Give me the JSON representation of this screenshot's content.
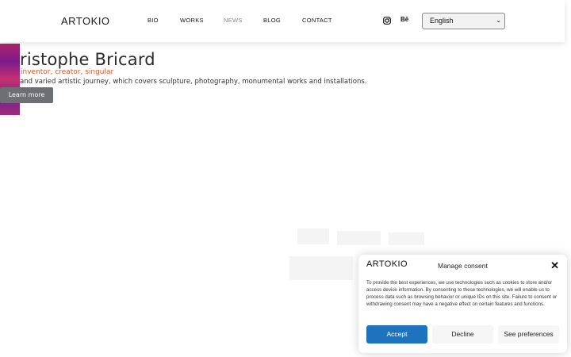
{
  "header": {
    "logo": "ARTOKIO",
    "nav": [
      {
        "label": "BIO",
        "active": false
      },
      {
        "label": "WORKS",
        "active": false
      },
      {
        "label": "NEWS",
        "active": true
      },
      {
        "label": "BLOG",
        "active": false
      },
      {
        "label": "CONTACT",
        "active": false
      }
    ],
    "social": {
      "instagram": "instagram-icon",
      "behance_label": "Bē"
    },
    "language": {
      "selected": "English"
    }
  },
  "hero": {
    "title": "ristophe Bricard",
    "subtitle": "inventor, creator, singular",
    "description": "and varied artistic journey, which covers sculpture, photography, monumental works and installations.",
    "cta": "Learn more"
  },
  "consent": {
    "logo": "ARTOKIO",
    "title": "Manage consent",
    "body": "To provide the best experiences, we use technologies such as cookies to store and/or access device information. By consenting to these technologies, we will enable us to process data such as browsing behavior or unique IDs on this site. Failure to consent or withdrawing consent may have a negative effect on certain features and functions.",
    "accept": "Accept",
    "decline": "Decline",
    "preferences": "See preferences"
  },
  "colors": {
    "accent": "#1e73be",
    "subtitle": "#d35a2b",
    "button_grey": "#6c6f73"
  }
}
